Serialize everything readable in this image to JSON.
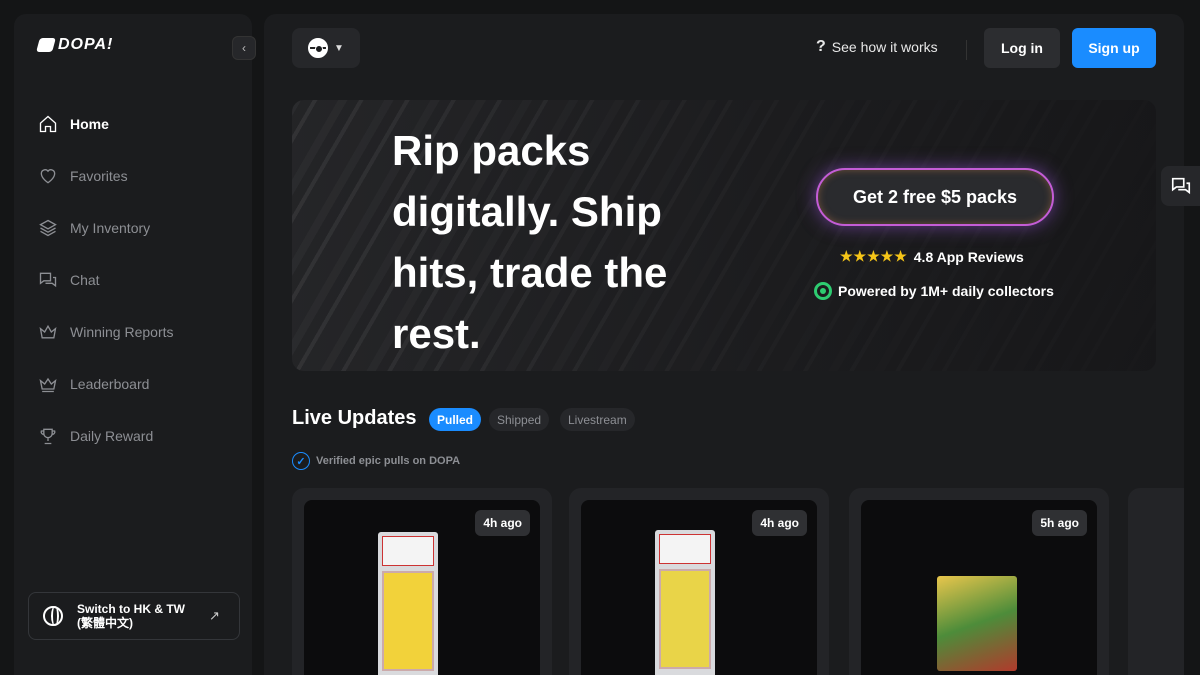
{
  "brand": {
    "name": "DOPA!"
  },
  "sidebar": {
    "items": [
      {
        "label": "Home",
        "icon": "home-icon",
        "active": true
      },
      {
        "label": "Favorites",
        "icon": "heart-icon"
      },
      {
        "label": "My Inventory",
        "icon": "layers-icon"
      },
      {
        "label": "Chat",
        "icon": "chat-icon"
      },
      {
        "label": "Winning Reports",
        "icon": "crown-icon"
      },
      {
        "label": "Leaderboard",
        "icon": "crown-icon"
      },
      {
        "label": "Daily Reward",
        "icon": "trophy-icon"
      }
    ],
    "lang_switch": {
      "line1": "Switch to HK & TW",
      "line2": "(繁體中文)"
    }
  },
  "header": {
    "how_it_works": "See how it works",
    "login": "Log in",
    "signup": "Sign up"
  },
  "hero": {
    "headline": "Rip packs digitally. Ship hits, trade the rest.",
    "cta": "Get 2 free $5 packs",
    "rating_stars": "★★★★★",
    "rating_text": "4.8 App Reviews",
    "powered": "Powered by 1M+ daily collectors"
  },
  "live": {
    "title": "Live Updates",
    "tabs": [
      "Pulled",
      "Shipped",
      "Livestream"
    ],
    "verified": "Verified epic pulls on DOPA",
    "cards": [
      {
        "time": "4h ago"
      },
      {
        "time": "4h ago"
      },
      {
        "time": "5h ago"
      }
    ]
  },
  "colors": {
    "accent": "#1a8cff",
    "background": "#141516",
    "panel": "#1b1c1e"
  }
}
